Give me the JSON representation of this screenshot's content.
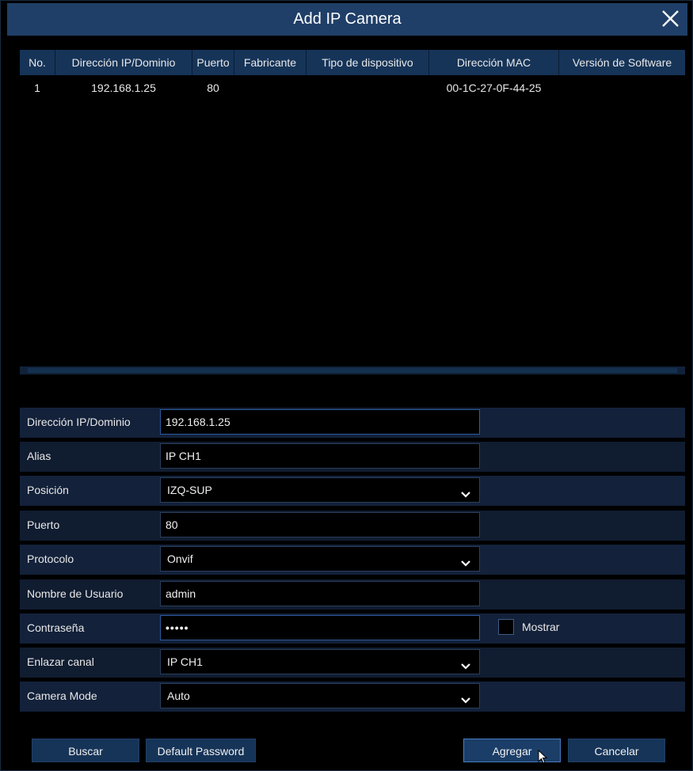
{
  "dialog": {
    "title": "Add IP Camera",
    "close_icon": "close-icon"
  },
  "table": {
    "columns": [
      "No.",
      "Dirección IP/Dominio",
      "Puerto",
      "Fabricante",
      "Tipo de dispositivo",
      "Dirección MAC",
      "Versión de Software"
    ],
    "rows": [
      {
        "no": "1",
        "ip": "192.168.1.25",
        "port": "80",
        "manufacturer": "",
        "device_type": "",
        "mac": "00-1C-27-0F-44-25",
        "software": ""
      }
    ]
  },
  "form": {
    "ip": {
      "label": "Dirección IP/Dominio",
      "value": "192.168.1.25"
    },
    "alias": {
      "label": "Alias",
      "value": "IP CH1"
    },
    "position": {
      "label": "Posición",
      "value": "IZQ-SUP"
    },
    "port": {
      "label": "Puerto",
      "value": "80"
    },
    "protocol": {
      "label": "Protocolo",
      "value": "Onvif"
    },
    "username": {
      "label": "Nombre de Usuario",
      "value": "admin"
    },
    "password": {
      "label": "Contraseña",
      "value": "•••••"
    },
    "show_password": {
      "label": "Mostrar",
      "checked": false
    },
    "channel": {
      "label": "Enlazar canal",
      "value": "IP CH1"
    },
    "camera_mode": {
      "label": "Camera Mode",
      "value": "Auto"
    }
  },
  "buttons": {
    "search": "Buscar",
    "default_password": "Default Password",
    "add": "Agregar",
    "cancel": "Cancelar"
  },
  "colors": {
    "title_bar": "#1f3f68",
    "header": "#163458",
    "background": "#000000",
    "input_border_focus": "#2e5b9c"
  }
}
